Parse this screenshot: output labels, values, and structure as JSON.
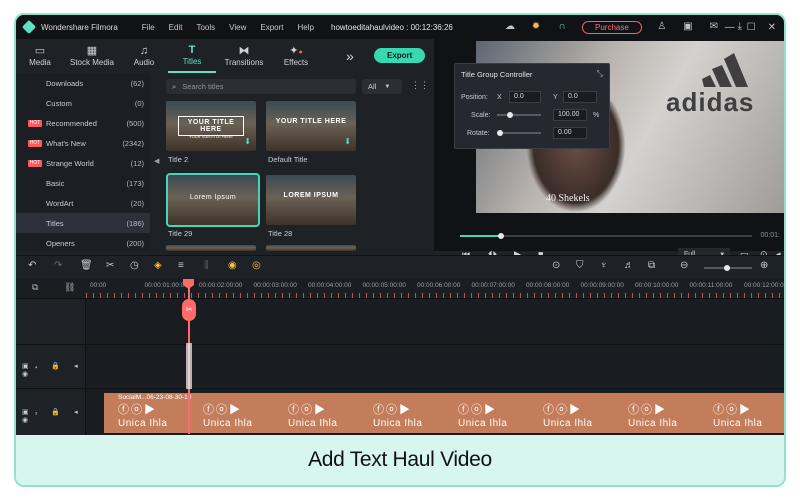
{
  "app": {
    "name": "Wondershare Filmora",
    "menu": [
      "File",
      "Edit",
      "Tools",
      "View",
      "Export",
      "Help"
    ],
    "project": "howtoeditahaulvideo : 00:12:36:26",
    "purchase": "Purchase"
  },
  "nav": {
    "tabs": [
      {
        "label": "Media",
        "icon": "folder-icon"
      },
      {
        "label": "Stock Media",
        "icon": "stock-media-icon"
      },
      {
        "label": "Audio",
        "icon": "music-note-icon"
      },
      {
        "label": "Titles",
        "icon": "text-t-icon"
      },
      {
        "label": "Transitions",
        "icon": "transitions-icon"
      },
      {
        "label": "Effects",
        "icon": "effects-icon"
      }
    ],
    "active": "Titles",
    "export": "Export"
  },
  "categories": [
    {
      "label": "Downloads",
      "count": "(62)",
      "hot": false
    },
    {
      "label": "Custom",
      "count": "(0)",
      "hot": false
    },
    {
      "label": "Recommended",
      "count": "(500)",
      "hot": true
    },
    {
      "label": "What's New",
      "count": "(2342)",
      "hot": true
    },
    {
      "label": "Strange World",
      "count": "(12)",
      "hot": true
    },
    {
      "label": "Basic",
      "count": "(173)",
      "hot": false
    },
    {
      "label": "WordArt",
      "count": "(20)",
      "hot": false
    },
    {
      "label": "Titles",
      "count": "(186)",
      "hot": false
    },
    {
      "label": "Openers",
      "count": "(200)",
      "hot": false
    }
  ],
  "hot_badge": "HOT",
  "search": {
    "placeholder": "Search titles",
    "filter": "All"
  },
  "thumbnails": [
    {
      "name": "Title 2",
      "text": "YOUR TITLE HERE",
      "sub": "YOUR SUBTITLE HERE"
    },
    {
      "name": "Default Title",
      "text": "YOUR TITLE HERE"
    },
    {
      "name": "Title 29",
      "text": "Lorem Ipsum"
    },
    {
      "name": "Title 28",
      "text": "LOREM IPSUM"
    }
  ],
  "title_group_controller": {
    "header": "Title Group Controller",
    "position_label": "Position:",
    "x_label": "X",
    "x_value": "0.0",
    "y_label": "Y",
    "y_value": "0.0",
    "scale_label": "Scale:",
    "scale_value": "100.00",
    "scale_unit": "%",
    "rotate_label": "Rotate:",
    "rotate_value": "0.00"
  },
  "preview": {
    "overlay_text": "40 Shekels",
    "brand_text": "adidas",
    "quality": "Full",
    "timecode": "00:01:"
  },
  "ruler": {
    "ticks": [
      "00:00",
      "00:00:01:00:00",
      "00:00:02:00:00",
      "00:00:03:00:00",
      "00:00:04:00:00",
      "00:00:05:00:00",
      "00:00:06:00:00",
      "00:00:07:00:00",
      "00:00:08:00:00",
      "00:00:09:00:00",
      "00:00:10:00:00",
      "00:00:11:00:00",
      "00:00:12:00:00"
    ]
  },
  "track": {
    "clip_name": "SocialM...06-23-08-30-10",
    "seg_brand": "Unica Ihla",
    "seg_icons": "ⓕⓞ▶"
  },
  "caption": "Add Text Haul Video"
}
